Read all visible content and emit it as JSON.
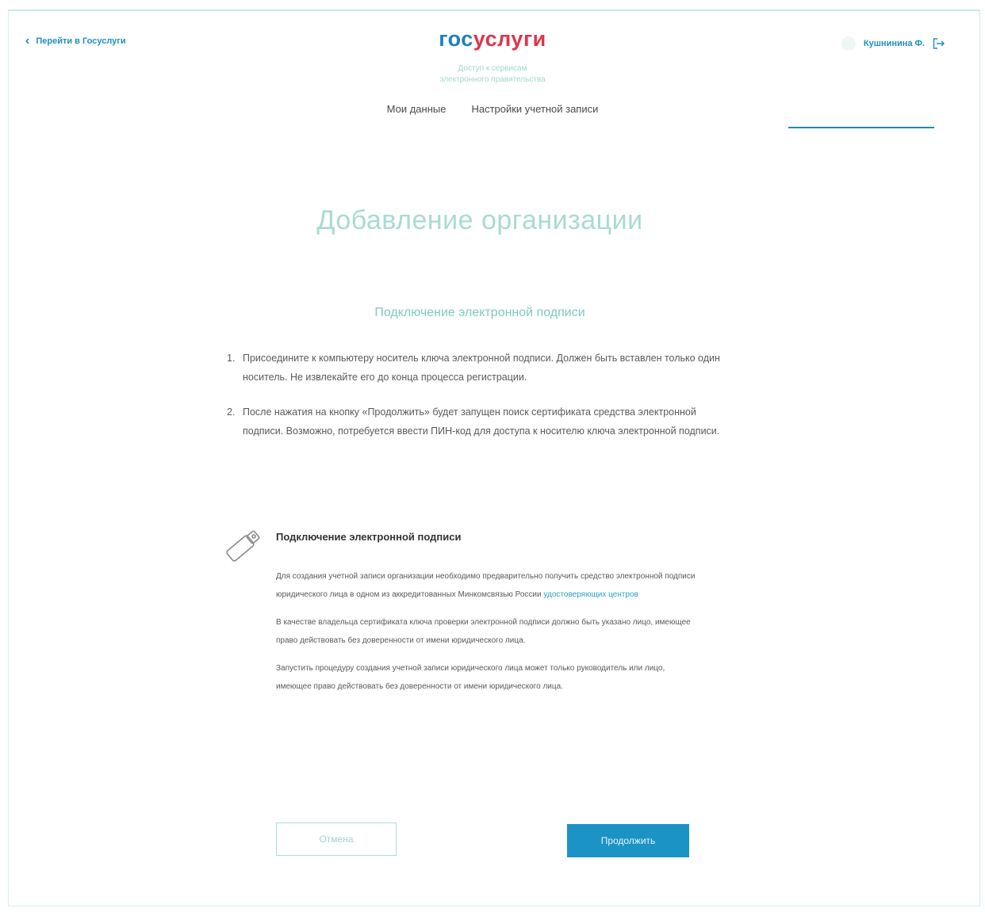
{
  "header": {
    "back_link": "Перейти в Госуслуги",
    "logo_part1": "гос",
    "logo_part2": "услуги",
    "tagline_line1": "Доступ к сервисам",
    "tagline_line2": "электронного правительства",
    "user_name": "Кушнинина Ф."
  },
  "nav": {
    "tabs": [
      {
        "label": "Мои данные"
      },
      {
        "label": "Настройки учетной записи"
      }
    ]
  },
  "page": {
    "title": "Добавление организации",
    "section_title": "Подключение электронной подписи"
  },
  "steps": [
    {
      "num": "1.",
      "text": "Присоедините к компьютеру носитель ключа электронной подписи. Должен быть вставлен только один носитель. Не извлекайте его до конца процесса регистрации."
    },
    {
      "num": "2.",
      "text": "После нажатия на кнопку «Продолжить» будет запущен поиск сертификата средства электронной подписи. Возможно, потребуется ввести ПИН-код для доступа к носителю ключа электронной подписи."
    }
  ],
  "info": {
    "title": "Подключение электронной подписи",
    "para1_text": "Для создания учетной записи организации необходимо предварительно получить средство электронной подписи юридического лица в одном из аккредитованных Минкомсвязью России ",
    "para1_link": "удостоверяющих центров",
    "para2": "В качестве владельца сертификата ключа проверки электронной подписи должно быть указано лицо, имеющее право действовать без доверенности от имени юридического лица.",
    "para3": "Запустить процедуру создания учетной записи юридического лица может только руководитель или лицо, имеющее право действовать без доверенности от имени юридического лица."
  },
  "buttons": {
    "cancel": "Отмена",
    "continue": "Продолжить"
  },
  "colors": {
    "brand_blue": "#1e7fc0",
    "brand_red": "#e0344b",
    "primary_button": "#1b93c4",
    "accent_teal": "#a8dbd2"
  }
}
